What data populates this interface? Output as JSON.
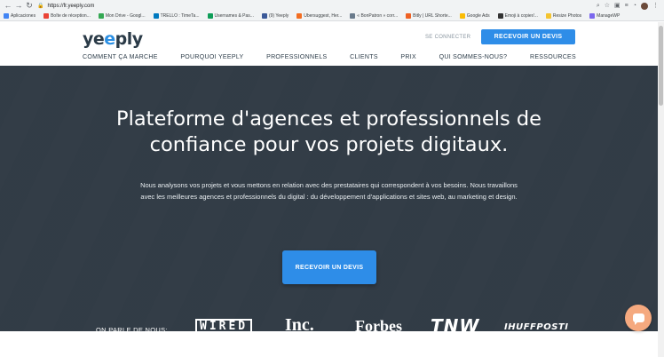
{
  "browser": {
    "url": "https://fr.yeeply.com",
    "bookmarks": [
      {
        "label": "Aplicaciones",
        "color": "#4285f4"
      },
      {
        "label": "Boîte de réception...",
        "color": "#ea4335"
      },
      {
        "label": "Mon Drive - Googl...",
        "color": "#34a853"
      },
      {
        "label": "TRELLO : TimeTa...",
        "color": "#0079bf"
      },
      {
        "label": "Usernames & Pas...",
        "color": "#0f9d58"
      },
      {
        "label": "(9) Yeeply",
        "color": "#3b5998"
      },
      {
        "label": "Ubersuggest, Her...",
        "color": "#f26d21"
      },
      {
        "label": "« BonPatron » corr...",
        "color": "#6a7b8c"
      },
      {
        "label": "Bitly | URL Shorte...",
        "color": "#ee6123"
      },
      {
        "label": "Google Ads",
        "color": "#fbbc04"
      },
      {
        "label": "Emoji à copier/...",
        "color": "#333333"
      },
      {
        "label": "Resize Photos",
        "color": "#f4c430"
      },
      {
        "label": "ManageWP",
        "color": "#7b68ee"
      }
    ]
  },
  "header": {
    "logo_prefix": "ye",
    "logo_eye": "e",
    "logo_suffix": "ply",
    "connect_label": "SE CONNECTER",
    "cta_label": "RECEVOIR UN DEVIS",
    "nav": [
      "COMMENT ÇA MARCHE",
      "POURQUOI YEEPLY",
      "PROFESSIONNELS",
      "CLIENTS",
      "PRIX",
      "QUI SOMMES-NOUS?",
      "RESSOURCES"
    ]
  },
  "hero": {
    "title_line1": "Plateforme d'agences et professionnels de",
    "title_line2": "confiance pour vos projets digitaux.",
    "sub_line1": "Nous analysons vos projets et vous mettons en relation avec des prestataires qui correspondent à vos besoins. Nous travaillons",
    "sub_line2": "avec les meilleures agences et professionnels du digital : du développement d'applications et sites web, au marketing et design.",
    "cta_label": "RECEVOIR UN DEVIS"
  },
  "press": {
    "label": "ON PARLE DE NOUS:",
    "logos": [
      "WIRED",
      "Inc.",
      "Forbes",
      "TNW",
      "IHUFFPOSTI"
    ]
  }
}
